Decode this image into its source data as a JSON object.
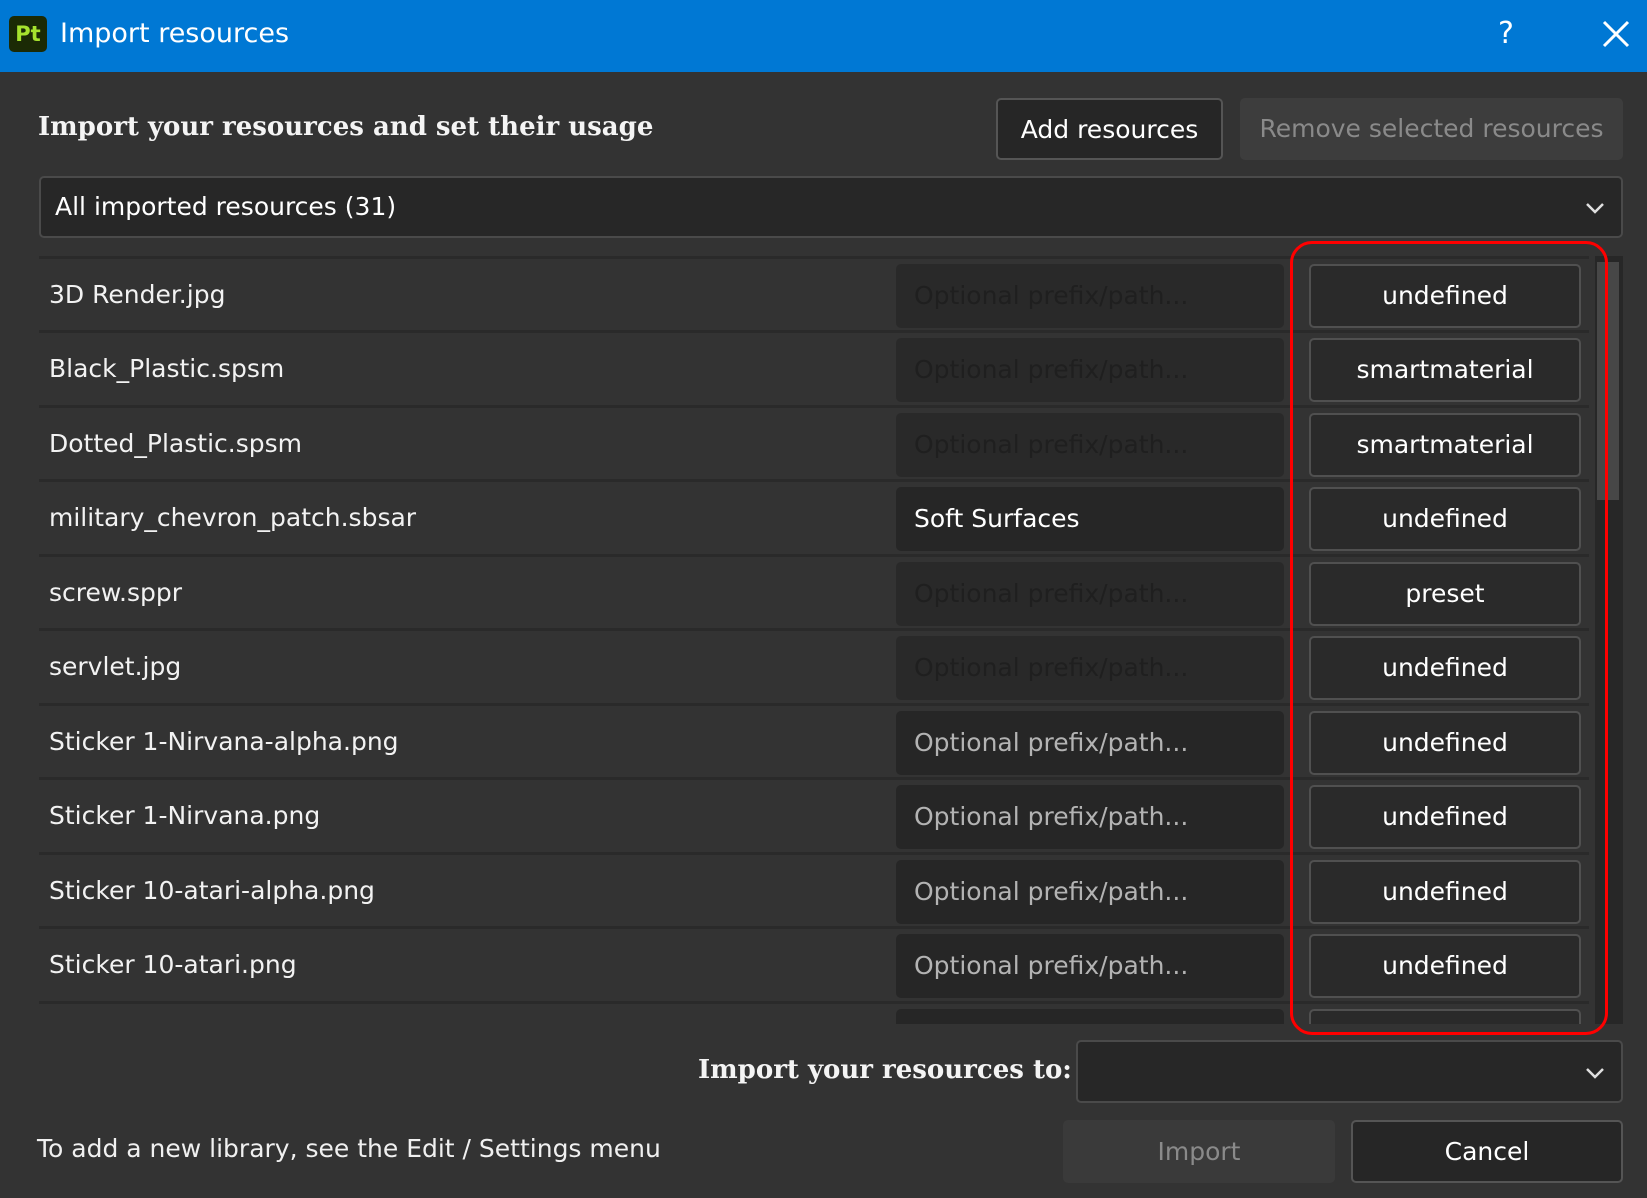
{
  "window": {
    "app_icon_label": "Pt",
    "title": "Import resources",
    "help_label": "?",
    "accent_color": "#0078d4"
  },
  "header": {
    "heading": "Import your resources and set their usage",
    "add_button": "Add resources",
    "remove_button": "Remove selected resources"
  },
  "filter": {
    "selected": "All imported resources (31)"
  },
  "resources": [
    {
      "name": "3D Render.jpg",
      "path_placeholder": "Optional prefix/path...",
      "path_value": "",
      "path_state": "disabled",
      "usage": "undefined"
    },
    {
      "name": "Black_Plastic.spsm",
      "path_placeholder": "Optional prefix/path...",
      "path_value": "",
      "path_state": "disabled",
      "usage": "smartmaterial"
    },
    {
      "name": "Dotted_Plastic.spsm",
      "path_placeholder": "Optional prefix/path...",
      "path_value": "",
      "path_state": "disabled",
      "usage": "smartmaterial"
    },
    {
      "name": "military_chevron_patch.sbsar",
      "path_placeholder": "Optional prefix/path...",
      "path_value": "Soft Surfaces",
      "path_state": "value",
      "usage": "undefined"
    },
    {
      "name": "screw.sppr",
      "path_placeholder": "Optional prefix/path...",
      "path_value": "",
      "path_state": "disabled",
      "usage": "preset"
    },
    {
      "name": "servlet.jpg",
      "path_placeholder": "Optional prefix/path...",
      "path_value": "",
      "path_state": "disabled",
      "usage": "undefined"
    },
    {
      "name": "Sticker 1-Nirvana-alpha.png",
      "path_placeholder": "Optional prefix/path...",
      "path_value": "",
      "path_state": "placeholder",
      "usage": "undefined"
    },
    {
      "name": "Sticker 1-Nirvana.png",
      "path_placeholder": "Optional prefix/path...",
      "path_value": "",
      "path_state": "placeholder",
      "usage": "undefined"
    },
    {
      "name": "Sticker 10-atari-alpha.png",
      "path_placeholder": "Optional prefix/path...",
      "path_value": "",
      "path_state": "placeholder",
      "usage": "undefined"
    },
    {
      "name": "Sticker 10-atari.png",
      "path_placeholder": "Optional prefix/path...",
      "path_value": "",
      "path_state": "placeholder",
      "usage": "undefined"
    },
    {
      "name": "",
      "path_placeholder": "",
      "path_value": "",
      "path_state": "placeholder",
      "usage": ""
    }
  ],
  "scroll": {
    "visible_fraction": 0.31,
    "position_fraction": 0.0
  },
  "destination": {
    "label": "Import your resources to:",
    "selected": ""
  },
  "footer": {
    "note": "To add a new library, see the Edit / Settings menu",
    "import_button": "Import",
    "cancel_button": "Cancel"
  },
  "annotation": {
    "highlight_color": "#ff0000",
    "highlighted_column": "usage"
  }
}
